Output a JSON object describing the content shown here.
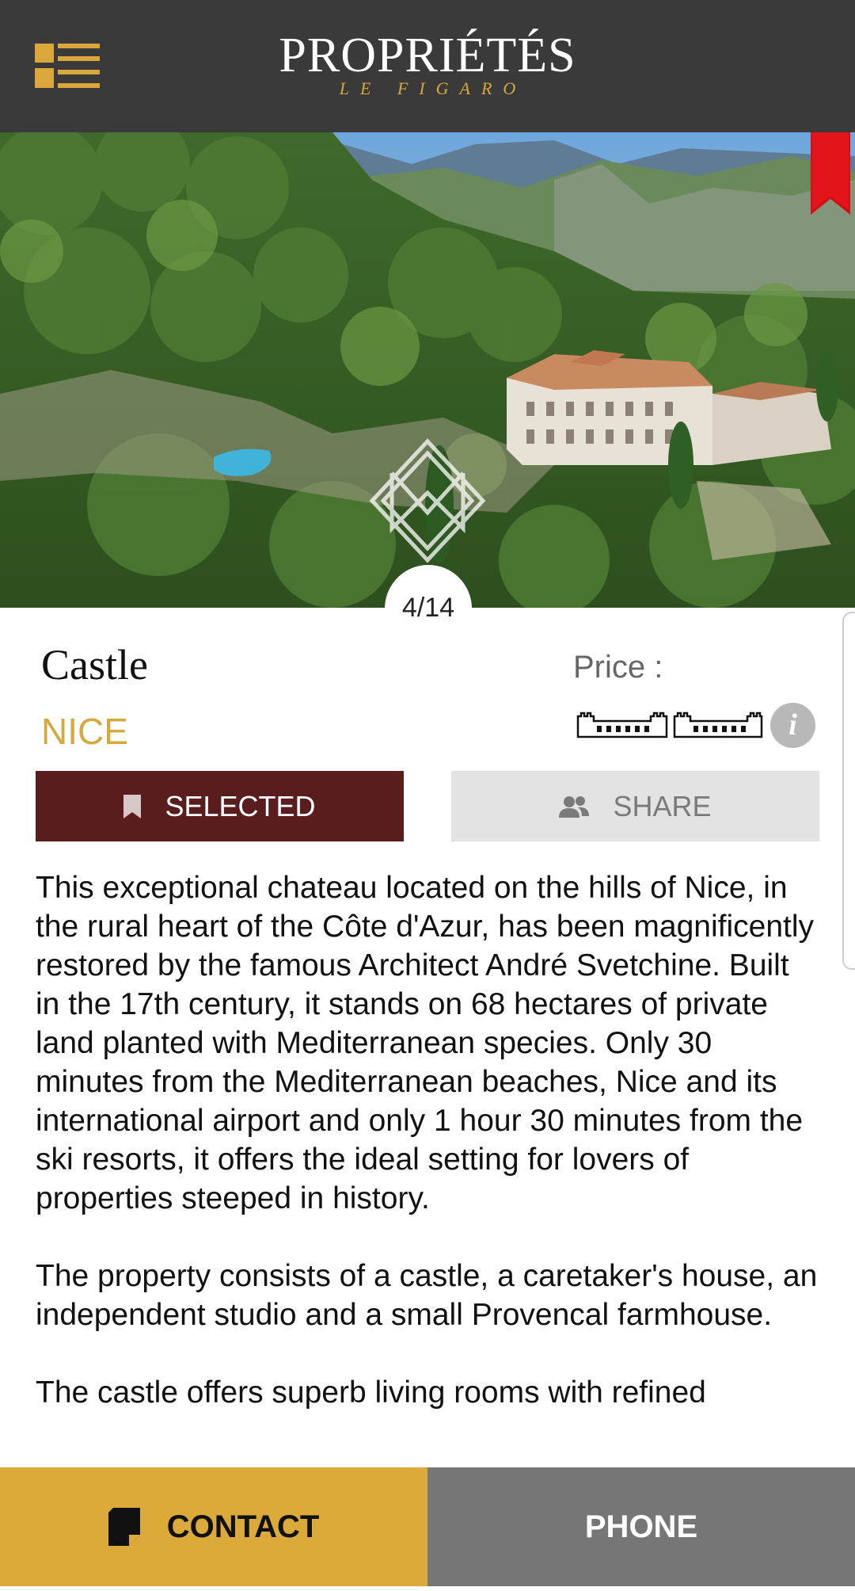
{
  "header": {
    "logo_title": "PROPRIÉTÉS",
    "logo_subtitle": "LE FIGARO",
    "menu_icon": "grid-list-icon",
    "background": "#3a3a3a",
    "accent": "#d9a73b"
  },
  "hero": {
    "image_counter": "4/14",
    "bookmark_icon": "ribbon-bookmark-icon",
    "watermark_icon": "monogram-watermark-icon",
    "ribbon_color": "#d30f16"
  },
  "listing": {
    "title": "Castle",
    "city": "NICE",
    "price_label": "Price :",
    "price_icons": "castle-icons",
    "info_icon_glyph": "i",
    "selected_label": "SELECTED",
    "share_label": "SHARE",
    "description": [
      "This exceptional chateau located on the hills of Nice, in the rural heart of the Côte d'Azur, has been magnificently restored by the famous Architect André Svetchine. Built in the 17th century, it stands on 68 hectares of private land planted with Mediterranean species. Only 30 minutes from the Mediterranean beaches, Nice and its international airport and only 1 hour 30 minutes from the ski resorts, it offers the ideal setting for lovers of properties steeped in history.",
      "The property consists of a castle, a caretaker's house, an independent studio and a small Provencal farmhouse.",
      "The castle offers superb living rooms with refined"
    ],
    "colors": {
      "city": "#d6a940",
      "selected_bg": "#5a1d1e",
      "share_bg": "#e3e3e3"
    }
  },
  "bottom_bar": {
    "contact_label": "CONTACT",
    "phone_label": "PHONE",
    "contact_bg": "#dcaa3a",
    "phone_bg": "#767676"
  }
}
